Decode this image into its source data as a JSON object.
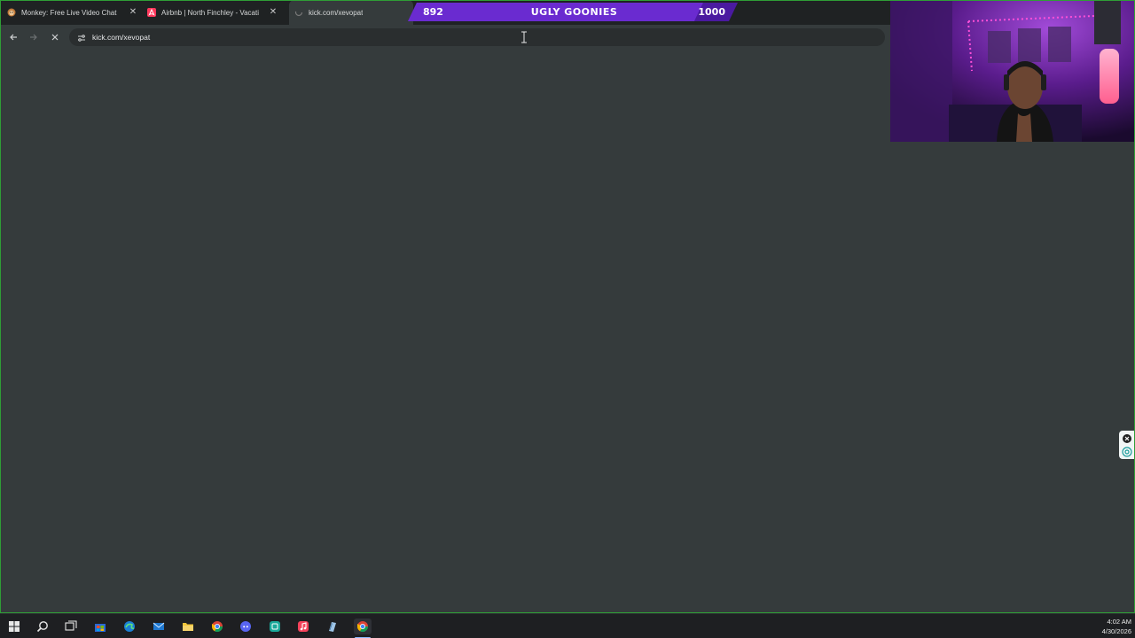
{
  "browser": {
    "tabs": [
      {
        "title": "Monkey: Free Live Video Chat w",
        "favicon": "monkey-icon",
        "active": false
      },
      {
        "title": "Airbnb | North Finchley - Vacation",
        "favicon": "airbnb-icon",
        "active": false
      },
      {
        "title": "kick.com/xevopat",
        "favicon": "loading-icon",
        "active": true
      }
    ],
    "url": "kick.com/xevopat",
    "loading": true
  },
  "overlay": {
    "goal_current": "892",
    "goal_title": "UGLY GOONIES",
    "goal_target": "1000",
    "goal_progress": 0.892,
    "accent_color": "#6a2bd0"
  },
  "taskbar": {
    "icons": [
      "windows-start-icon",
      "search-icon",
      "task-view-icon",
      "store-icon",
      "edge-icon",
      "mail-icon",
      "file-explorer-icon",
      "chrome-icon",
      "discord-icon",
      "app-icon",
      "music-icon",
      "notes-icon",
      "chrome-active-icon"
    ],
    "time": "4:02 AM",
    "date": "4/30/2026"
  },
  "colors": {
    "page_background": "#353b3c",
    "tabstrip_background": "#1f2223",
    "taskbar_background": "#1e1f22",
    "border_accent": "#2f9e36"
  }
}
